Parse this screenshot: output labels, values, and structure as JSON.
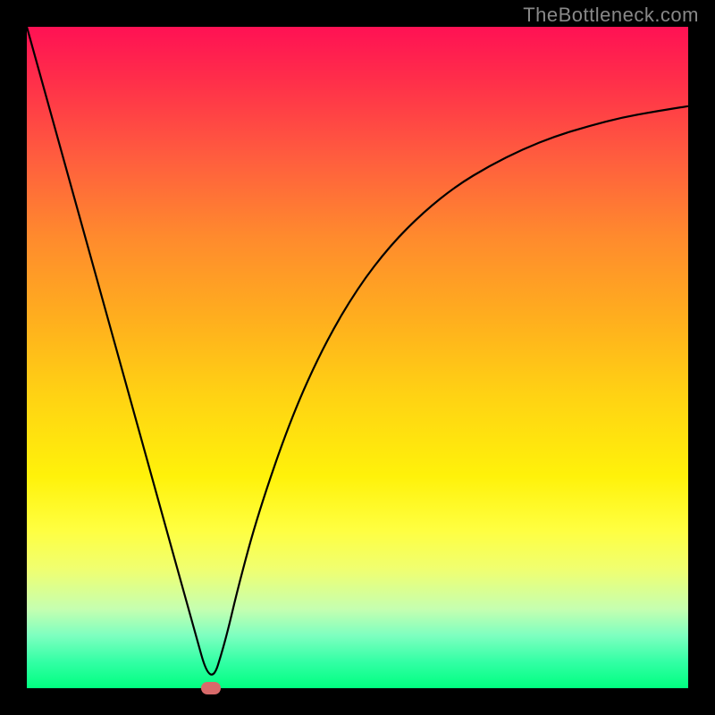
{
  "watermark": "TheBottleneck.com",
  "chart_data": {
    "type": "line",
    "title": "",
    "xlabel": "",
    "ylabel": "",
    "xlim": [
      0,
      1
    ],
    "ylim": [
      0,
      1
    ],
    "series": [
      {
        "name": "curve",
        "x": [
          0.0,
          0.05,
          0.1,
          0.15,
          0.2,
          0.25,
          0.278,
          0.3,
          0.32,
          0.35,
          0.4,
          0.45,
          0.5,
          0.55,
          0.6,
          0.65,
          0.7,
          0.75,
          0.8,
          0.85,
          0.9,
          0.95,
          1.0
        ],
        "y": [
          1.0,
          0.82,
          0.64,
          0.46,
          0.28,
          0.1,
          0.0,
          0.07,
          0.155,
          0.265,
          0.41,
          0.52,
          0.605,
          0.67,
          0.72,
          0.76,
          0.79,
          0.815,
          0.835,
          0.85,
          0.863,
          0.872,
          0.88
        ]
      }
    ],
    "marker": {
      "x": 0.278,
      "y": 0.0
    },
    "background_gradient": {
      "orientation": "vertical",
      "stops": [
        {
          "pos": 0.0,
          "color": "#ff1154"
        },
        {
          "pos": 0.5,
          "color": "#ffd313"
        },
        {
          "pos": 0.8,
          "color": "#ffff40"
        },
        {
          "pos": 1.0,
          "color": "#00ff80"
        }
      ]
    }
  }
}
